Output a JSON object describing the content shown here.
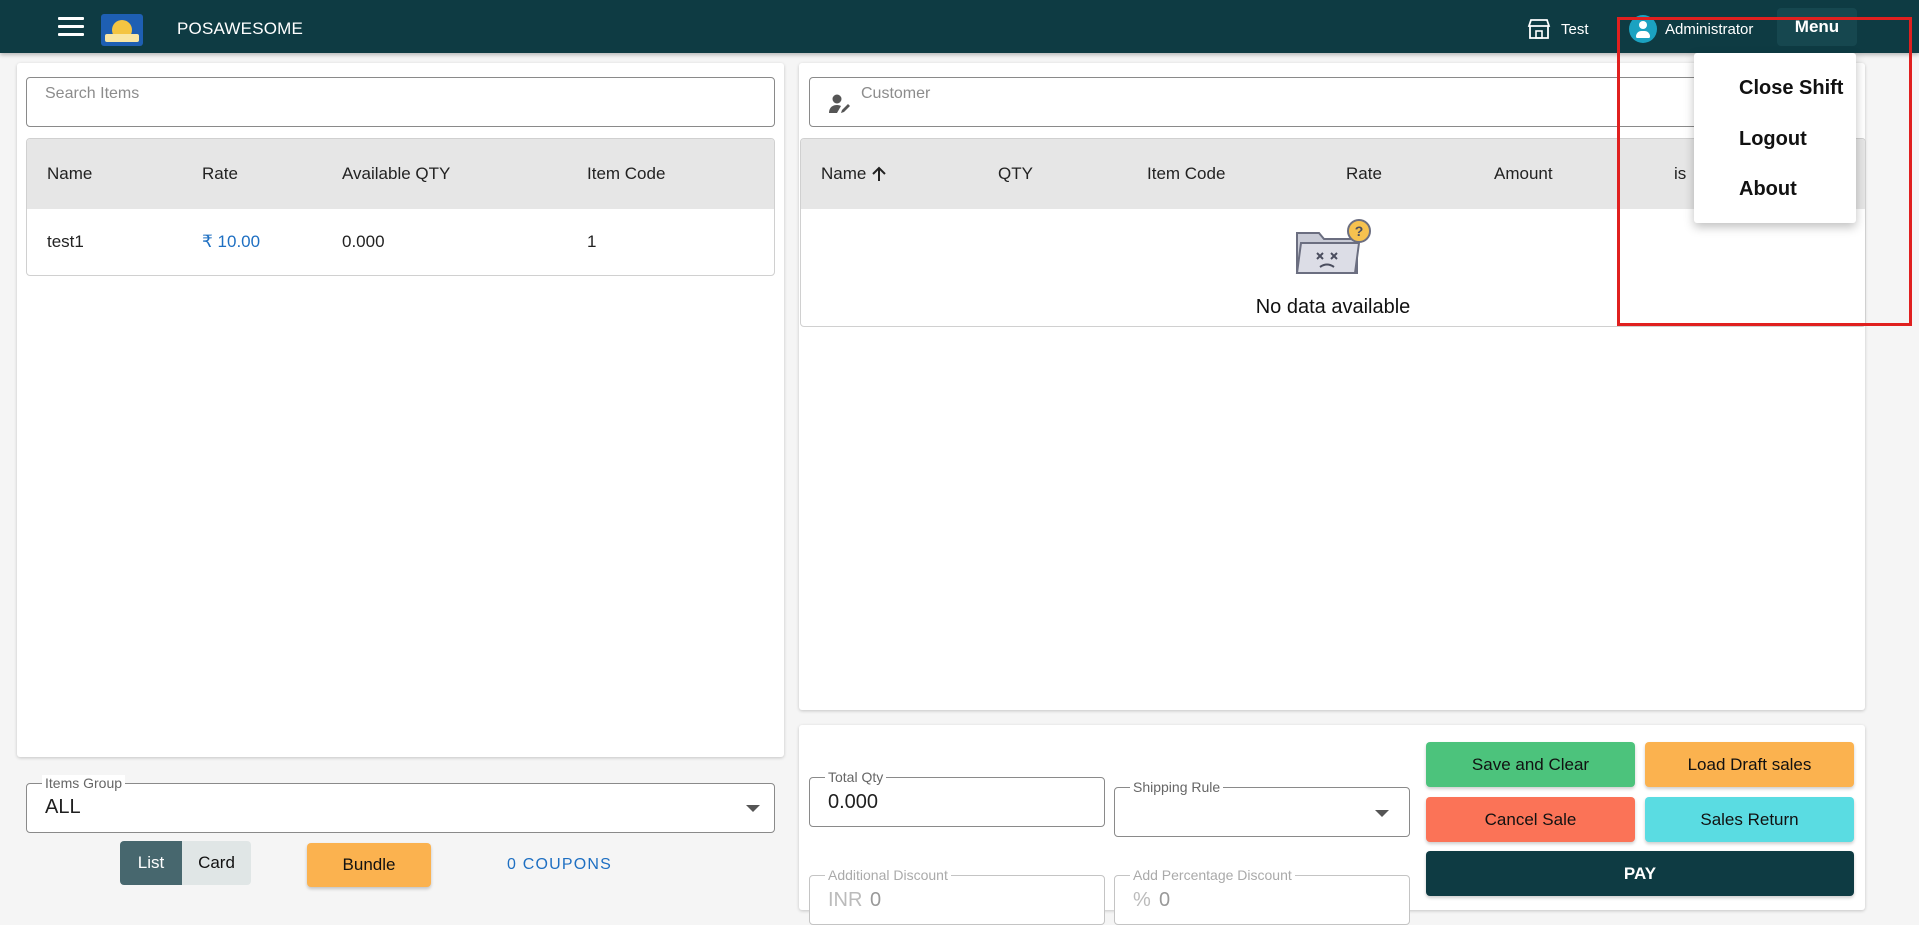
{
  "topbar": {
    "brand": "POSAWESOME",
    "store": "Test",
    "user": "Administrator",
    "menu_label": "Menu"
  },
  "items_panel": {
    "search_placeholder": "Search Items",
    "columns": [
      "Name",
      "Rate",
      "Available QTY",
      "Item Code"
    ],
    "rows": [
      {
        "name": "test1",
        "rate": "₹ 10.00",
        "qty": "0.000",
        "code": "1"
      }
    ]
  },
  "items_group": {
    "label": "Items Group",
    "value": "ALL"
  },
  "view_toggle": {
    "list": "List",
    "card": "Card"
  },
  "bundle_label": "Bundle",
  "coupons_label": "0 COUPONS",
  "invoice_panel": {
    "customer_placeholder": "Customer",
    "columns": [
      "Name",
      "QTY",
      "Item Code",
      "Rate",
      "Amount",
      "is"
    ],
    "empty_text": "No data available"
  },
  "totals": {
    "total_qty_label": "Total Qty",
    "total_qty_value": "0.000",
    "shipping_rule_label": "Shipping Rule",
    "additional_discount_label": "Additional Discount",
    "additional_discount_prefix": "INR",
    "additional_discount_value": "0",
    "percentage_discount_label": "Add Percentage Discount",
    "percentage_discount_prefix": "%",
    "percentage_discount_value": "0"
  },
  "actions": {
    "save_clear": "Save and Clear",
    "load_draft": "Load Draft sales",
    "cancel_sale": "Cancel Sale",
    "sales_return": "Sales Return",
    "pay": "PAY"
  },
  "menu_dropdown": {
    "items": [
      "Close Shift",
      "Logout",
      "About"
    ]
  },
  "colors": {
    "topbar": "#0e3b43",
    "save_clear": "#4cc37c",
    "load_draft": "#fbb24f",
    "cancel_sale": "#fb7357",
    "sales_return": "#5adce2",
    "pay": "#0e3b43",
    "highlight": "#e0201f"
  }
}
